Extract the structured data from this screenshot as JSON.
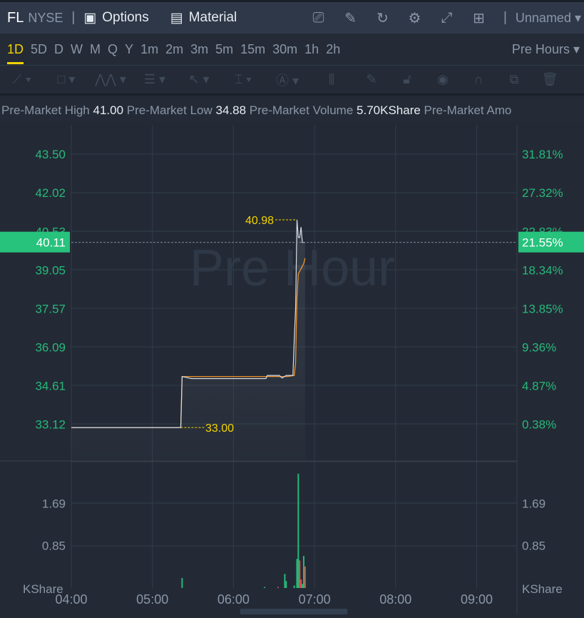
{
  "header": {
    "symbol": "FL",
    "exchange": "NYSE",
    "options_label": "Options",
    "material_label": "Material",
    "layout_name": "Unnamed",
    "icons": [
      "chart-monitor-icon",
      "edit-icon",
      "refresh-icon",
      "gear-icon",
      "fullscreen-icon",
      "grid-layout-icon"
    ]
  },
  "timeframes": [
    "1D",
    "5D",
    "D",
    "W",
    "M",
    "Q",
    "Y",
    "1m",
    "2m",
    "3m",
    "5m",
    "15m",
    "30m",
    "1h",
    "2h"
  ],
  "active_timeframe": "1D",
  "session_selector": "Pre Hours",
  "drawing_tools": [
    "line-tool-icon",
    "rectangle-tool-icon",
    "pattern-tool-icon",
    "fibonacci-tool-icon",
    "arrow-tool-icon",
    "measure-tool-icon",
    "text-tool-icon",
    "indicator-icon",
    "pen-icon",
    "lock-icon",
    "eye-icon",
    "magnet-icon",
    "copy-icon",
    "trash-icon"
  ],
  "stats": [
    {
      "label": "Pre-Market High",
      "value": "41.00"
    },
    {
      "label": "Pre-Market Low",
      "value": "34.88"
    },
    {
      "label": "Pre-Market Volume",
      "value": "5.70KShare"
    },
    {
      "label": "Pre-Market Amo",
      "value": ""
    }
  ],
  "colors": {
    "up": "#26b97a",
    "down": "#e0504a",
    "price_line": "#d8dde5",
    "avg_line": "#f0902a",
    "label": "#f5d300",
    "tag": "#27c27c"
  },
  "chart_data": {
    "type": "line",
    "watermark": "Pre Hour",
    "x_ticks": [
      "04:00",
      "05:00",
      "06:00",
      "07:00",
      "08:00",
      "09:00"
    ],
    "y_ticks_left": [
      "43.50",
      "42.02",
      "40.53",
      "39.05",
      "37.57",
      "36.09",
      "34.61",
      "33.12"
    ],
    "y_ticks_right": [
      "31.81%",
      "27.32%",
      "22.83%",
      "18.34%",
      "13.85%",
      "9.36%",
      "4.87%",
      "0.38%"
    ],
    "ylim": [
      32.9,
      44.3
    ],
    "current_price": "40.11",
    "current_change": "21.55%",
    "high_label": "40.98",
    "low_label": "33.00",
    "price_series": {
      "x": [
        "04:00",
        "05:21",
        "05:22",
        "05:29",
        "06:24",
        "06:25",
        "06:34",
        "06:36",
        "06:39",
        "06:44",
        "06:45",
        "06:46",
        "06:47",
        "06:48",
        "06:49",
        "06:50",
        "06:51",
        "06:52",
        "06:53"
      ],
      "y": [
        33.0,
        33.0,
        34.96,
        34.88,
        34.88,
        35.0,
        35.0,
        34.9,
        35.0,
        35.0,
        36.4,
        37.6,
        40.98,
        40.3,
        40.3,
        40.7,
        40.11,
        40.11,
        40.11
      ]
    },
    "avg_series": {
      "x": [
        "04:00",
        "05:21",
        "05:22",
        "06:40",
        "06:45",
        "06:46",
        "06:47",
        "06:48",
        "06:50",
        "06:52",
        "06:53"
      ],
      "y": [
        33.0,
        33.0,
        34.96,
        34.96,
        35.0,
        35.5,
        38.0,
        38.9,
        39.1,
        39.3,
        39.5
      ]
    },
    "volume": {
      "unit": "KShare",
      "y_ticks": [
        "1.69",
        "0.85"
      ],
      "ylim": [
        0,
        2.4
      ],
      "bars": [
        {
          "t": "05:22",
          "v": 0.2,
          "dir": "up"
        },
        {
          "t": "06:23",
          "v": 0.02,
          "dir": "up"
        },
        {
          "t": "06:33",
          "v": 0.02,
          "dir": "down"
        },
        {
          "t": "06:38",
          "v": 0.28,
          "dir": "up"
        },
        {
          "t": "06:39",
          "v": 0.14,
          "dir": "up"
        },
        {
          "t": "06:45",
          "v": 0.05,
          "dir": "up"
        },
        {
          "t": "06:47",
          "v": 0.58,
          "dir": "up"
        },
        {
          "t": "06:48",
          "v": 2.28,
          "dir": "up"
        },
        {
          "t": "06:49",
          "v": 0.55,
          "dir": "down"
        },
        {
          "t": "06:50",
          "v": 0.17,
          "dir": "down"
        },
        {
          "t": "06:51",
          "v": 0.08,
          "dir": "up"
        },
        {
          "t": "06:52",
          "v": 0.64,
          "dir": "up"
        },
        {
          "t": "06:53",
          "v": 0.43,
          "dir": "down"
        }
      ]
    }
  }
}
